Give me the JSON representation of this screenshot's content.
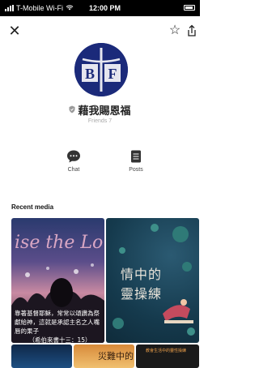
{
  "status_bar": {
    "carrier": "T-Mobile Wi-Fi",
    "time": "12:00 PM"
  },
  "profile": {
    "avatar_letters": [
      "B",
      "F"
    ],
    "name": "藉我賜恩福",
    "friends": "Friends 7"
  },
  "actions": [
    {
      "label": "Chat",
      "icon": "chat-bubble-icon"
    },
    {
      "label": "Posts",
      "icon": "posts-icon"
    }
  ],
  "recent_media": {
    "title": "Recent media",
    "items": [
      {
        "overlay_script": "ise the Lo",
        "overlay_text_lines": [
          "靠著基督耶穌，常常以頌讚為祭",
          "獻給神，這就是承認主名之人嘴唇的果子",
          "（希伯來書十三：15）"
        ]
      },
      {
        "overlay_text_lines": [
          "情中的",
          "靈操練"
        ]
      },
      {
        "overlay_text_lines": []
      },
      {
        "overlay_text_lines": [
          "災難中的"
        ]
      },
      {
        "overlay_text_lines": [
          "教會生活中的靈性操練"
        ]
      }
    ]
  },
  "colors": {
    "avatar_bg": "#1b2a7a",
    "avatar_ring": "#e6e6ef"
  }
}
